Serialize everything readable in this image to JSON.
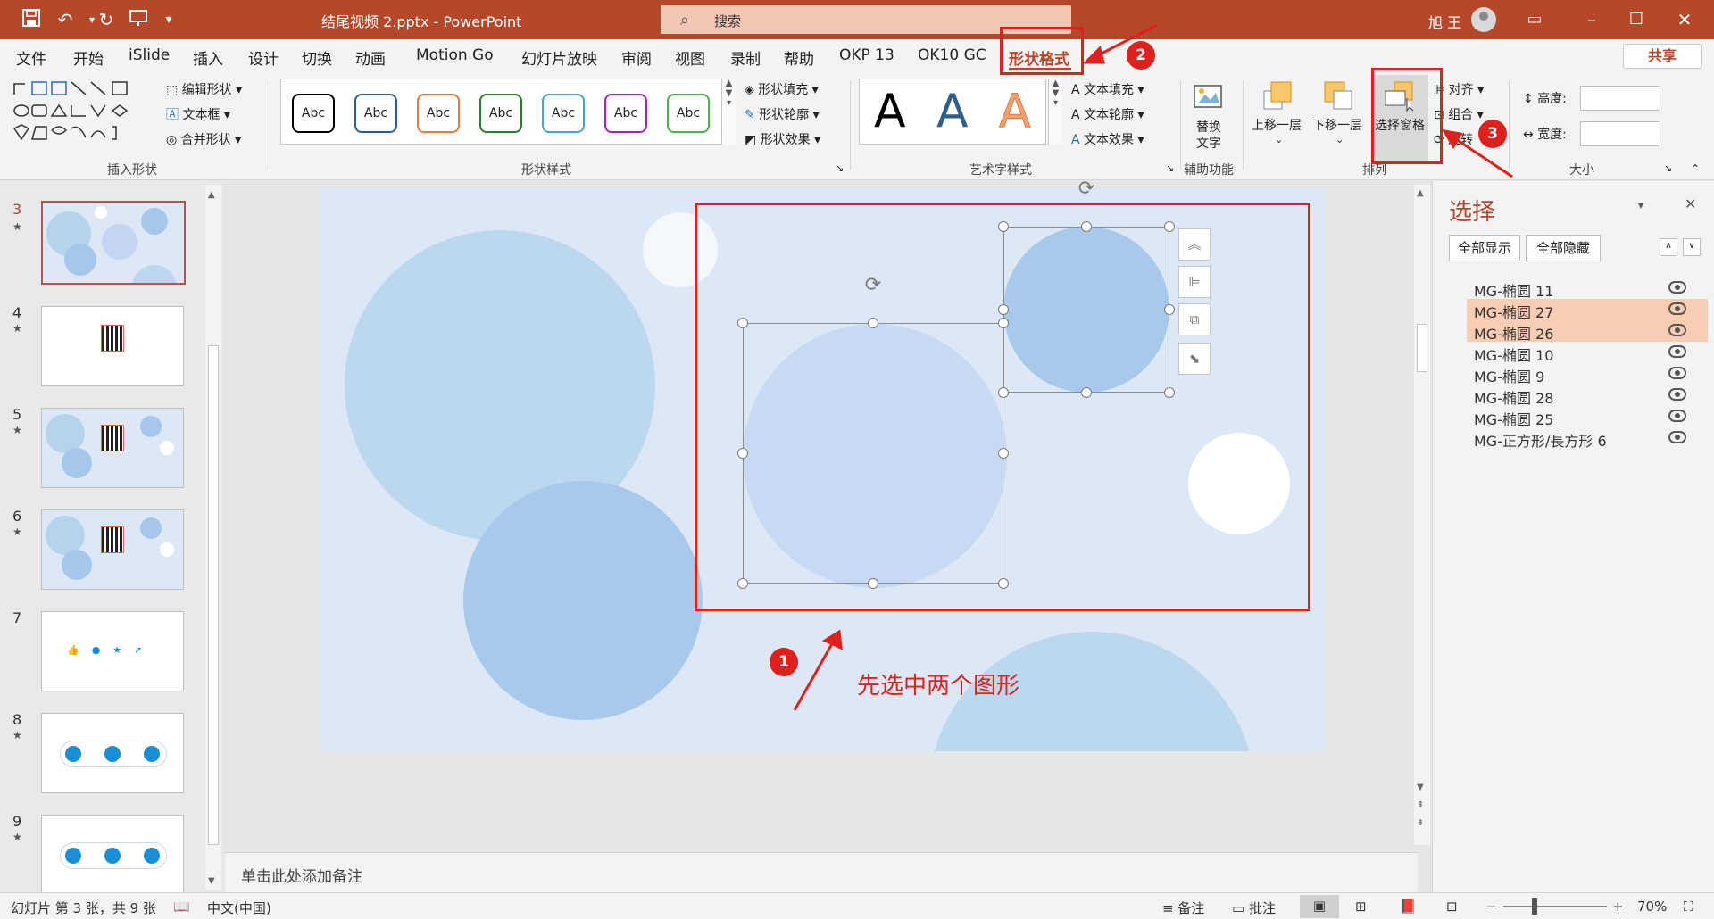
{
  "titlebar": {
    "title": "结尾视频 2.pptx  -  PowerPoint",
    "search_label": "搜索",
    "user_name": "旭 王"
  },
  "menu": {
    "items": [
      "文件",
      "开始",
      "iSlide",
      "插入",
      "设计",
      "切换",
      "动画",
      "Motion Go",
      "幻灯片放映",
      "审阅",
      "视图",
      "录制",
      "帮助",
      "OKP 13",
      "OK10 GC",
      "形状格式"
    ],
    "active": "形状格式",
    "share_label": "共享"
  },
  "ribbon": {
    "insert_shapes": {
      "edit_shape": "编辑形状",
      "text_box": "文本框",
      "merge_shapes": "合并形状",
      "group_label": "插入形状"
    },
    "shape_styles": {
      "preset_label": "Abc",
      "preset_colors": [
        "#000000",
        "#2e5f8a",
        "#e07b39",
        "#2e7d32",
        "#43a6c6",
        "#9c27b0",
        "#4caf50"
      ],
      "fill": "形状填充",
      "outline": "形状轮廓",
      "effects": "形状效果",
      "group_label": "形状样式"
    },
    "art_styles": {
      "letter": "A",
      "text_fill": "文本填充",
      "text_outline": "文本轮廓",
      "text_effects": "文本效果",
      "group_label": "艺术字样式"
    },
    "accessibility": {
      "alt_text_line1": "替换",
      "alt_text_line2": "文字",
      "group_label": "辅助功能"
    },
    "arrange": {
      "bring_forward": "上移一层",
      "send_backward": "下移一层",
      "selection_pane": "选择窗格",
      "align": "对齐",
      "group": "组合",
      "rotate": "旋转",
      "group_label": "排列"
    },
    "size": {
      "height_label": "高度:",
      "width_label": "宽度:",
      "group_label": "大小"
    }
  },
  "thumbnails": [
    {
      "num": "3",
      "star": "★",
      "active": true,
      "kind": "circles"
    },
    {
      "num": "4",
      "star": "★",
      "active": false,
      "kind": "white-qr"
    },
    {
      "num": "5",
      "star": "★",
      "active": false,
      "kind": "blue-qr"
    },
    {
      "num": "6",
      "star": "★",
      "active": false,
      "kind": "blue-qr"
    },
    {
      "num": "7",
      "star": "",
      "active": false,
      "kind": "icons-row"
    },
    {
      "num": "8",
      "star": "★",
      "active": false,
      "kind": "icons-bubble"
    },
    {
      "num": "9",
      "star": "★",
      "active": false,
      "kind": "icons-bubble"
    }
  ],
  "annotations": {
    "step1": "1",
    "step2": "2",
    "step3": "3",
    "note": "先选中两个图形"
  },
  "notes_placeholder": "单击此处添加备注",
  "selection_pane": {
    "title": "选择",
    "show_all": "全部显示",
    "hide_all": "全部隐藏",
    "layers": [
      {
        "name": "MG-椭圆 11",
        "selected": false
      },
      {
        "name": "MG-椭圆 27",
        "selected": true
      },
      {
        "name": "MG-椭圆 26",
        "selected": true
      },
      {
        "name": "MG-椭圆 10",
        "selected": false
      },
      {
        "name": "MG-椭圆 9",
        "selected": false
      },
      {
        "name": "MG-椭圆 28",
        "selected": false
      },
      {
        "name": "MG-椭圆 25",
        "selected": false
      },
      {
        "name": "MG-正方形/長方形 6",
        "selected": false
      }
    ]
  },
  "statusbar": {
    "slide_info": "幻灯片 第 3 张，共 9 张",
    "language": "中文(中国)",
    "notes": "备注",
    "comments": "批注",
    "zoom": "70%"
  },
  "colors": {
    "accent": "#b7472a",
    "annotation_red": "#e0201c",
    "slide_bg": "#dce8f6",
    "selected_layer": "#f9cdb4"
  }
}
